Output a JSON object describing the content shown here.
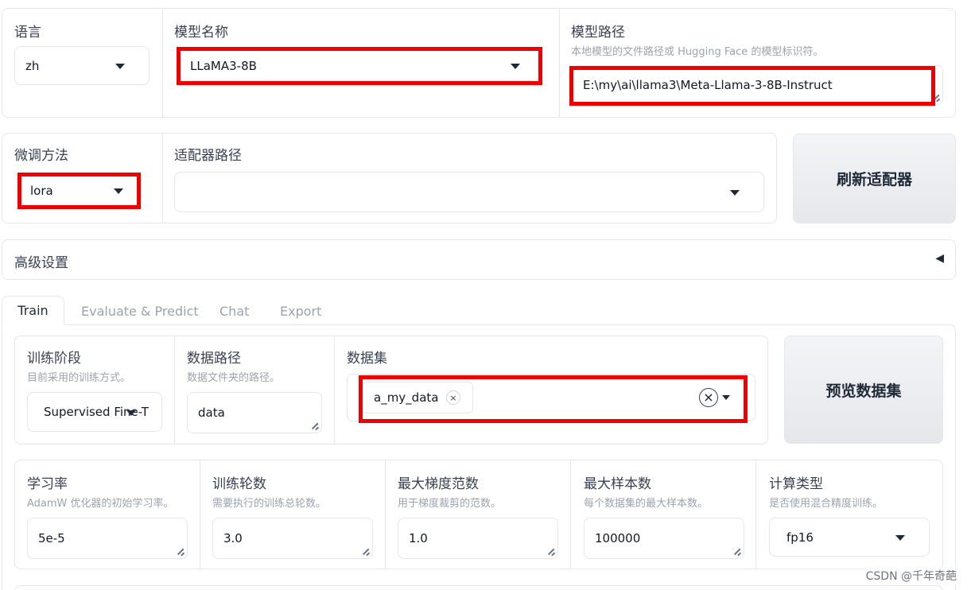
{
  "top_row": {
    "language": {
      "label": "语言",
      "value": "zh"
    },
    "model_name": {
      "label": "模型名称",
      "value": "LLaMA3-8B"
    },
    "model_path": {
      "label": "模型路径",
      "info": "本地模型的文件路径或 Hugging Face 的模型标识符。",
      "value": "E:\\my\\ai\\llama3\\Meta-Llama-3-8B-Instruct"
    }
  },
  "second_row": {
    "finetune_method": {
      "label": "微调方法",
      "value": "lora"
    },
    "adapter_path": {
      "label": "适配器路径",
      "value": ""
    },
    "refresh_button": "刷新适配器"
  },
  "advanced": {
    "label": "高级设置",
    "toggle": "◀"
  },
  "tabs": [
    {
      "label": "Train",
      "active": true
    },
    {
      "label": "Evaluate & Predict",
      "active": false
    },
    {
      "label": "Chat",
      "active": false
    },
    {
      "label": "Export",
      "active": false
    }
  ],
  "train": {
    "stage": {
      "label": "训练阶段",
      "info": "目前采用的训练方式。",
      "value": "Supervised Fine-T"
    },
    "dataset_dir": {
      "label": "数据路径",
      "info": "数据文件夹的路径。",
      "value": "data"
    },
    "dataset": {
      "label": "数据集",
      "tags": [
        "a_my_data"
      ],
      "tag_remove": "×",
      "clear": "×"
    },
    "preview_button": "预览数据集",
    "learning_rate": {
      "label": "学习率",
      "info": "AdamW 优化器的初始学习率。",
      "value": "5e-5"
    },
    "epochs": {
      "label": "训练轮数",
      "info": "需要执行的训练总轮数。",
      "value": "3.0"
    },
    "max_grad_norm": {
      "label": "最大梯度范数",
      "info": "用于梯度裁剪的范数。",
      "value": "1.0"
    },
    "max_samples": {
      "label": "最大样本数",
      "info": "每个数据集的最大样本数。",
      "value": "100000"
    },
    "compute_type": {
      "label": "计算类型",
      "info": "是否使用混合精度训练。",
      "value": "fp16"
    }
  },
  "watermark": "CSDN @千年奇葩",
  "colors": {
    "highlight": "#ee0000",
    "border": "#e5e7eb",
    "muted": "#9ca3af"
  }
}
